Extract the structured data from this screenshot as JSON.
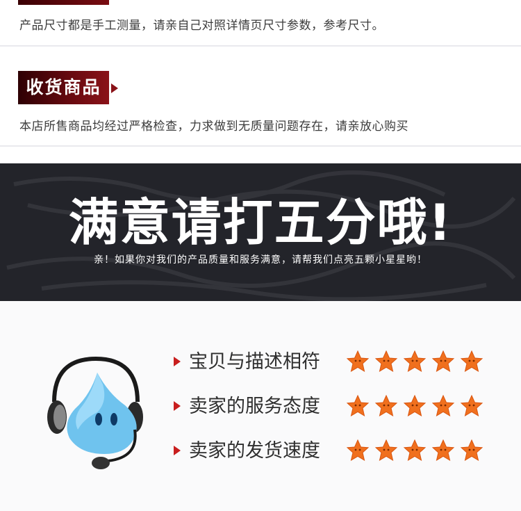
{
  "size_note": {
    "text": "产品尺寸都是手工测量，请亲自己对照详情页尺寸参数，参考尺寸。"
  },
  "receiving": {
    "tag": "收货商品",
    "text": "本店所售商品均经过严格检查，力求做到无质量问题存在，请亲放心购买"
  },
  "banner": {
    "title": "满意请打五分哦!",
    "subtitle": "亲！如果你对我们的产品质量和服务满意，请帮我们点亮五颗小星星哟！"
  },
  "ratings": [
    {
      "label": "宝贝与描述相符",
      "stars": 5
    },
    {
      "label": "卖家的服务态度",
      "stars": 5
    },
    {
      "label": "卖家的发货速度",
      "stars": 5
    }
  ],
  "colors": {
    "accent": "#7a0d12",
    "star_fill": "#f0701e",
    "arrow": "#c81e1e",
    "banner_bg": "#23242a"
  },
  "icons": {
    "mascot": "headset-support-mascot-icon",
    "star": "star-icon"
  }
}
